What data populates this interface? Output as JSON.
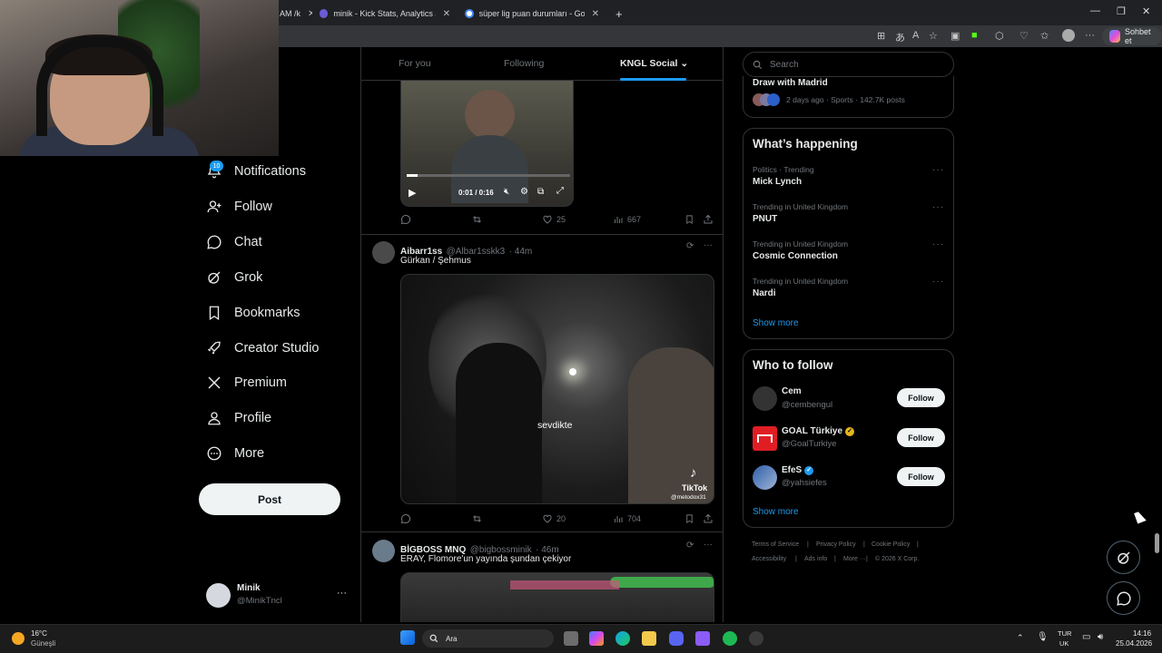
{
  "browser": {
    "tabs": [
      {
        "title": "AM /k"
      },
      {
        "title": "minik - Kick Stats, Analytics and C"
      },
      {
        "title": "süper lig puan durumları - Google"
      }
    ],
    "new_tab": "+",
    "chat_button": "Sohbet et"
  },
  "nav": {
    "notifications_badge": "10",
    "items": [
      {
        "label": "Notifications",
        "icon": "bell-icon"
      },
      {
        "label": "Follow",
        "icon": "person-add-icon"
      },
      {
        "label": "Chat",
        "icon": "chat-icon"
      },
      {
        "label": "Grok",
        "icon": "grok-icon"
      },
      {
        "label": "Bookmarks",
        "icon": "bookmark-icon"
      },
      {
        "label": "Creator Studio",
        "icon": "rocket-icon"
      },
      {
        "label": "Premium",
        "icon": "x-logo-icon"
      },
      {
        "label": "Profile",
        "icon": "person-icon"
      },
      {
        "label": "More",
        "icon": "more-circle-icon"
      }
    ],
    "post_button": "Post",
    "account": {
      "name": "Minik",
      "handle": "@MinikTncl",
      "menu": "···"
    }
  },
  "timeline": {
    "tabs": [
      "For you",
      "Following",
      "KNGL Social"
    ],
    "active_tab": "KNGL Social",
    "video_player": {
      "time": "0:01 / 0:16"
    },
    "posts": [
      {
        "replies": "",
        "reposts": "",
        "likes": "25",
        "views": "667"
      },
      {
        "name": "Aibarr1ss",
        "handle": "@Albar1sskk3",
        "time": "· 44m",
        "text": "Gürkan / Şehmus",
        "media_caption": "sevdikte",
        "watermark": "TikTok",
        "watermark_handle": "@metodox31",
        "likes": "20",
        "views": "704"
      },
      {
        "name": "BİGBOSS MNQ",
        "handle": "@bigbossminik",
        "time": "· 46m",
        "text": "ERAY, Flomore'un yayında şundan çekiyor"
      }
    ]
  },
  "sidebar": {
    "search_placeholder": "Search",
    "top_trend": {
      "title": "Draw with Madrid",
      "meta": "2 days ago · Sports · 142.7K posts"
    },
    "whats_happening": {
      "title": "What’s happening",
      "trends": [
        {
          "meta": "Politics · Trending",
          "name": "Mick Lynch"
        },
        {
          "meta": "Trending in United Kingdom",
          "name": "PNUT"
        },
        {
          "meta": "Trending in United Kingdom",
          "name": "Cosmic Connection"
        },
        {
          "meta": "Trending in United Kingdom",
          "name": "Nardi"
        }
      ],
      "show_more": "Show more"
    },
    "who_to_follow": {
      "title": "Who to follow",
      "accounts": [
        {
          "name": "Cem",
          "handle": "@cembengul",
          "button": "Follow"
        },
        {
          "name": "GOAL Türkiye",
          "handle": "@GoalTurkiye",
          "button": "Follow"
        },
        {
          "name": "EfeS",
          "handle": "@yahsiefes",
          "button": "Follow"
        }
      ],
      "show_more": "Show more"
    },
    "footer": {
      "links": [
        "Terms of Service",
        "Privacy Policy",
        "Cookie Policy",
        "Accessibility",
        "Ads info",
        "More ···"
      ],
      "copyright": "© 2026 X Corp."
    }
  },
  "taskbar": {
    "weather_temp": "16°C",
    "weather_desc": "Güneşli",
    "search": "Ara",
    "lang_top": "TUR",
    "lang_bottom": "UK",
    "time": "14:16",
    "date": "25.04.2026"
  },
  "colors": {
    "accent": "#1d9bf0",
    "background": "#000000",
    "border": "#2f3336",
    "muted": "#71767b"
  }
}
